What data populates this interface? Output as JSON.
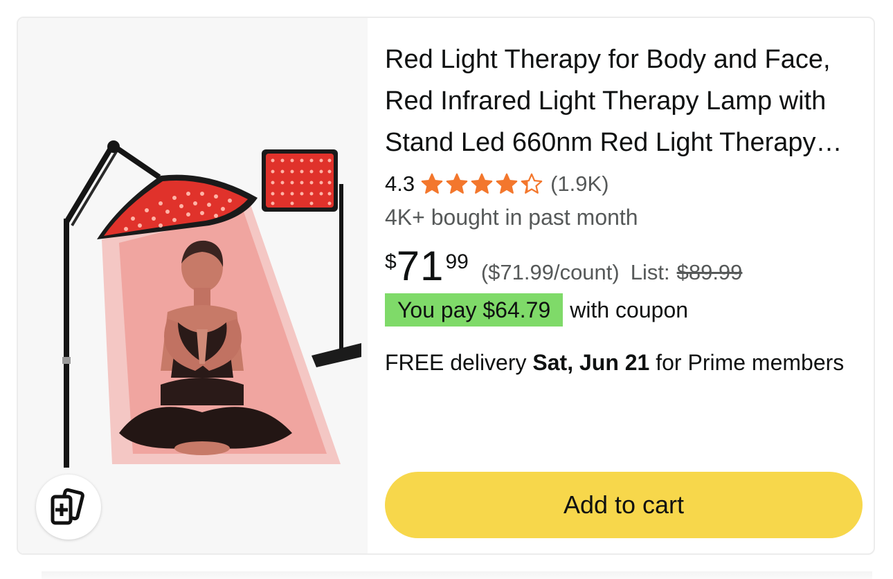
{
  "product": {
    "title": "Red Light Therapy for Body and Face, Red Infrared Light Therapy Lamp with Stand Led 660nm Red Light Therapy Device",
    "rating": "4.3",
    "rating_stars": 4.3,
    "review_count": "(1.9K)",
    "bought_text": "4K+ bought in past month",
    "price": {
      "symbol": "$",
      "whole": "71",
      "fraction": "99"
    },
    "unit_price": "($71.99/count)",
    "list_label": "List:",
    "list_price": "$89.99",
    "coupon": {
      "badge": "You pay $64.79",
      "suffix": "with coupon"
    },
    "delivery": {
      "prefix": "FREE delivery",
      "date": "Sat, Jun 21",
      "suffix": "for Prime members"
    },
    "add_to_cart_label": "Add to cart",
    "compare_icon": "add-to-compare-icon"
  },
  "colors": {
    "star": "#f3772d",
    "coupon_badge": "#7fda69",
    "cart_button": "#f7d74b",
    "text": "#0f1111",
    "muted_text": "#565959"
  }
}
